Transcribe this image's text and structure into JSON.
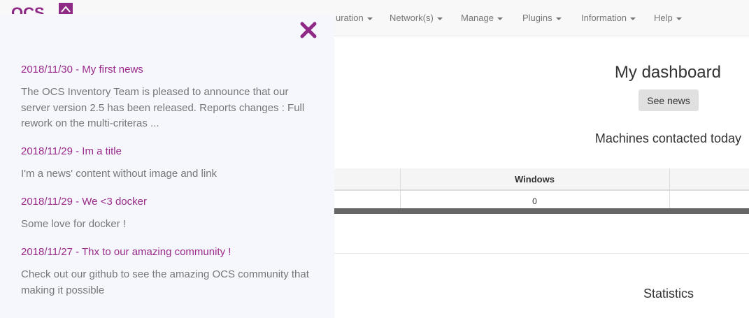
{
  "navbar": {
    "brand": "OCS",
    "items": [
      {
        "label": "uration"
      },
      {
        "label": "Network(s)"
      },
      {
        "label": "Manage"
      },
      {
        "label": "Plugins"
      },
      {
        "label": "Information"
      },
      {
        "label": "Help"
      }
    ]
  },
  "main": {
    "dashboard_title": "My dashboard",
    "see_news_label": "See news",
    "machines_title": "Machines contacted today",
    "table": {
      "headers": [
        "",
        "Windows",
        ""
      ],
      "rows": [
        [
          "",
          "0",
          ""
        ]
      ]
    },
    "statistics_title": "Statistics"
  },
  "news": {
    "items": [
      {
        "title": "2018/11/30 - My first news",
        "body": "The OCS Inventory Team is pleased to announce that our server version 2.5 has been released. Reports changes : Full rework on the multi-criteras ..."
      },
      {
        "title": "2018/11/29 - Im a title",
        "body": "I'm a news' content without image and link"
      },
      {
        "title": "2018/11/29 - We <3 docker",
        "body": "Some love for docker !"
      },
      {
        "title": "2018/11/27 - Thx to our amazing community !",
        "body": "Check out our github to see the amazing OCS community that making it possible"
      }
    ]
  },
  "colors": {
    "accent": "#9a2a8a",
    "panel_bg": "#f5f7fd",
    "navbar_bg": "#f8f8f8"
  },
  "icons": {
    "close": "close-icon",
    "caret": "caret-down-icon"
  }
}
